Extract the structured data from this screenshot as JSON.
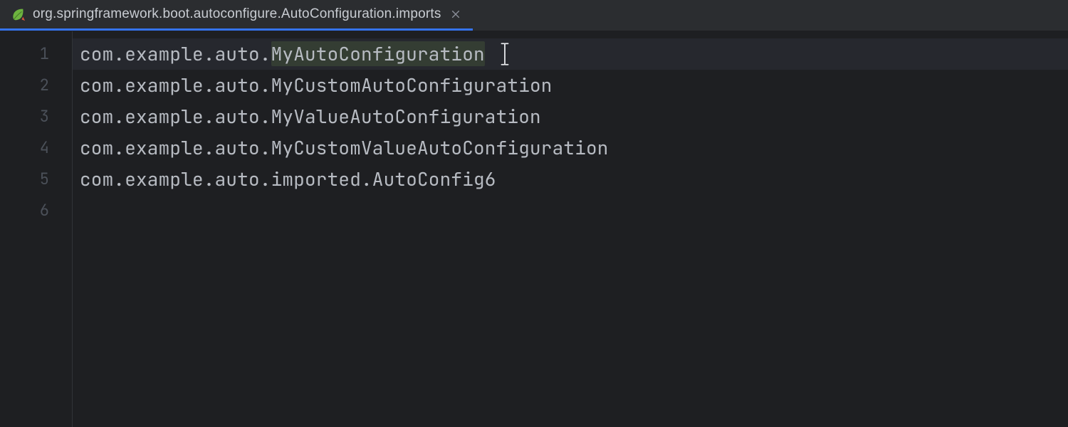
{
  "tab": {
    "label": "org.springframework.boot.autoconfigure.AutoConfiguration.imports",
    "icon_name": "spring-leaf-icon",
    "close_name": "close-icon"
  },
  "editor": {
    "lines": [
      {
        "number": 1,
        "text": "com.example.auto.MyAutoConfiguration"
      },
      {
        "number": 2,
        "text": "com.example.auto.MyCustomAutoConfiguration"
      },
      {
        "number": 3,
        "text": "com.example.auto.MyValueAutoConfiguration"
      },
      {
        "number": 4,
        "text": "com.example.auto.MyCustomValueAutoConfiguration"
      },
      {
        "number": 5,
        "text": "com.example.auto.imported.AutoConfig6"
      },
      {
        "number": 6,
        "text": ""
      }
    ],
    "active_line": 1,
    "highlight": {
      "line": 1,
      "start": 17,
      "end": 36
    }
  }
}
